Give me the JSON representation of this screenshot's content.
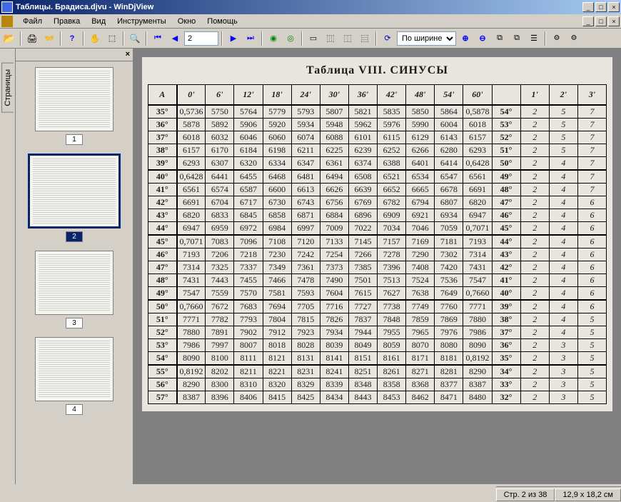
{
  "window": {
    "title": "Таблицы. Брадиса.djvu - WinDjView",
    "min": "_",
    "max": "□",
    "close": "×"
  },
  "menu": {
    "file": "Файл",
    "edit": "Правка",
    "view": "Вид",
    "tools": "Инструменты",
    "window": "Окно",
    "help": "Помощь"
  },
  "toolbar": {
    "page_value": "2",
    "zoom_value": "По ширине"
  },
  "sidebar": {
    "tab_label": "Страницы",
    "thumbs": [
      {
        "label": "1",
        "selected": false
      },
      {
        "label": "2",
        "selected": true
      },
      {
        "label": "3",
        "selected": false
      },
      {
        "label": "4",
        "selected": false
      }
    ]
  },
  "document": {
    "title": "Таблица VIII. СИНУСЫ",
    "headers": [
      "A",
      "0'",
      "6'",
      "12'",
      "18'",
      "24'",
      "30'",
      "36'",
      "42'",
      "48'",
      "54'",
      "60'",
      "",
      "1'",
      "2'",
      "3'"
    ],
    "rows": [
      [
        "35°",
        "0,5736",
        "5750",
        "5764",
        "5779",
        "5793",
        "5807",
        "5821",
        "5835",
        "5850",
        "5864",
        "0,5878",
        "54°",
        "2",
        "5",
        "7"
      ],
      [
        "36°",
        "5878",
        "5892",
        "5906",
        "5920",
        "5934",
        "5948",
        "5962",
        "5976",
        "5990",
        "6004",
        "6018",
        "53°",
        "2",
        "5",
        "7"
      ],
      [
        "37°",
        "6018",
        "6032",
        "6046",
        "6060",
        "6074",
        "6088",
        "6101",
        "6115",
        "6129",
        "6143",
        "6157",
        "52°",
        "2",
        "5",
        "7"
      ],
      [
        "38°",
        "6157",
        "6170",
        "6184",
        "6198",
        "6211",
        "6225",
        "6239",
        "6252",
        "6266",
        "6280",
        "6293",
        "51°",
        "2",
        "5",
        "7"
      ],
      [
        "39°",
        "6293",
        "6307",
        "6320",
        "6334",
        "6347",
        "6361",
        "6374",
        "6388",
        "6401",
        "6414",
        "0,6428",
        "50°",
        "2",
        "4",
        "7"
      ],
      [
        "40°",
        "0,6428",
        "6441",
        "6455",
        "6468",
        "6481",
        "6494",
        "6508",
        "6521",
        "6534",
        "6547",
        "6561",
        "49°",
        "2",
        "4",
        "7"
      ],
      [
        "41°",
        "6561",
        "6574",
        "6587",
        "6600",
        "6613",
        "6626",
        "6639",
        "6652",
        "6665",
        "6678",
        "6691",
        "48°",
        "2",
        "4",
        "7"
      ],
      [
        "42°",
        "6691",
        "6704",
        "6717",
        "6730",
        "6743",
        "6756",
        "6769",
        "6782",
        "6794",
        "6807",
        "6820",
        "47°",
        "2",
        "4",
        "6"
      ],
      [
        "43°",
        "6820",
        "6833",
        "6845",
        "6858",
        "6871",
        "6884",
        "6896",
        "6909",
        "6921",
        "6934",
        "6947",
        "46°",
        "2",
        "4",
        "6"
      ],
      [
        "44°",
        "6947",
        "6959",
        "6972",
        "6984",
        "6997",
        "7009",
        "7022",
        "7034",
        "7046",
        "7059",
        "0,7071",
        "45°",
        "2",
        "4",
        "6"
      ],
      [
        "45°",
        "0,7071",
        "7083",
        "7096",
        "7108",
        "7120",
        "7133",
        "7145",
        "7157",
        "7169",
        "7181",
        "7193",
        "44°",
        "2",
        "4",
        "6"
      ],
      [
        "46°",
        "7193",
        "7206",
        "7218",
        "7230",
        "7242",
        "7254",
        "7266",
        "7278",
        "7290",
        "7302",
        "7314",
        "43°",
        "2",
        "4",
        "6"
      ],
      [
        "47°",
        "7314",
        "7325",
        "7337",
        "7349",
        "7361",
        "7373",
        "7385",
        "7396",
        "7408",
        "7420",
        "7431",
        "42°",
        "2",
        "4",
        "6"
      ],
      [
        "48°",
        "7431",
        "7443",
        "7455",
        "7466",
        "7478",
        "7490",
        "7501",
        "7513",
        "7524",
        "7536",
        "7547",
        "41°",
        "2",
        "4",
        "6"
      ],
      [
        "49°",
        "7547",
        "7559",
        "7570",
        "7581",
        "7593",
        "7604",
        "7615",
        "7627",
        "7638",
        "7649",
        "0,7660",
        "40°",
        "2",
        "4",
        "6"
      ],
      [
        "50°",
        "0,7660",
        "7672",
        "7683",
        "7694",
        "7705",
        "7716",
        "7727",
        "7738",
        "7749",
        "7760",
        "7771",
        "39°",
        "2",
        "4",
        "6"
      ],
      [
        "51°",
        "7771",
        "7782",
        "7793",
        "7804",
        "7815",
        "7826",
        "7837",
        "7848",
        "7859",
        "7869",
        "7880",
        "38°",
        "2",
        "4",
        "5"
      ],
      [
        "52°",
        "7880",
        "7891",
        "7902",
        "7912",
        "7923",
        "7934",
        "7944",
        "7955",
        "7965",
        "7976",
        "7986",
        "37°",
        "2",
        "4",
        "5"
      ],
      [
        "53°",
        "7986",
        "7997",
        "8007",
        "8018",
        "8028",
        "8039",
        "8049",
        "8059",
        "8070",
        "8080",
        "8090",
        "36°",
        "2",
        "3",
        "5"
      ],
      [
        "54°",
        "8090",
        "8100",
        "8111",
        "8121",
        "8131",
        "8141",
        "8151",
        "8161",
        "8171",
        "8181",
        "0,8192",
        "35°",
        "2",
        "3",
        "5"
      ],
      [
        "55°",
        "0,8192",
        "8202",
        "8211",
        "8221",
        "8231",
        "8241",
        "8251",
        "8261",
        "8271",
        "8281",
        "8290",
        "34°",
        "2",
        "3",
        "5"
      ],
      [
        "56°",
        "8290",
        "8300",
        "8310",
        "8320",
        "8329",
        "8339",
        "8348",
        "8358",
        "8368",
        "8377",
        "8387",
        "33°",
        "2",
        "3",
        "5"
      ],
      [
        "57°",
        "8387",
        "8396",
        "8406",
        "8415",
        "8425",
        "8434",
        "8443",
        "8453",
        "8462",
        "8471",
        "8480",
        "32°",
        "2",
        "3",
        "5"
      ]
    ],
    "group_breaks": [
      5,
      10,
      15,
      20
    ]
  },
  "status": {
    "page": "Стр. 2 из 38",
    "size": "12,9 x 18,2 см"
  }
}
